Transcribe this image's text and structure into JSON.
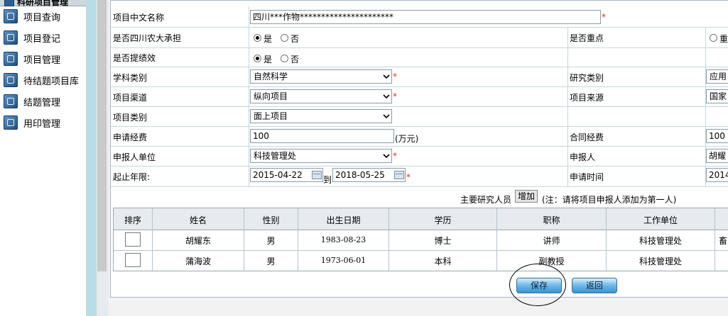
{
  "sidebar": {
    "title": "科研项目管理",
    "items": [
      {
        "label": "项目查询"
      },
      {
        "label": "项目登记"
      },
      {
        "label": "项目管理"
      },
      {
        "label": "待结题项目库"
      },
      {
        "label": "结题管理"
      },
      {
        "label": "用印管理"
      }
    ]
  },
  "form": {
    "project_name_label": "项目中文名称",
    "project_name_value": "四川***作物**********************",
    "required_mark": "*",
    "undertaken_label": "是否四川农大承担",
    "yes_label": "是",
    "no_label": "否",
    "key_label": "是否重点",
    "key_option_label": "重",
    "performance_label": "是否提绩效",
    "discipline_label": "学科类别",
    "discipline_value": "自然科学",
    "research_type_label": "研究类别",
    "research_type_value": "应用",
    "channel_label": "项目渠道",
    "channel_value": "纵向项目",
    "source_label": "项目来源",
    "source_value": "国家",
    "category_label": "项目类别",
    "category_value": "面上项目",
    "funding_label": "申请经费",
    "funding_value": "100",
    "funding_unit": "(万元)",
    "contract_funding_label": "合同经费",
    "contract_funding_value": "100",
    "unit_label": "申报人单位",
    "unit_value": "科技管理处",
    "applicant_label": "申报人",
    "applicant_value": "胡耀",
    "period_label": "起止年限:",
    "start_date": "2015-04-22",
    "to_label": "到",
    "end_date": "2018-05-25",
    "apply_time_label": "申请时间",
    "apply_time_value": "2014",
    "researchers_label": "主要研究人员",
    "add_button": "增加",
    "researchers_note": "(注：请将项目申报人添加为第一人)"
  },
  "table": {
    "headers": [
      "排序",
      "姓名",
      "性别",
      "出生日期",
      "学历",
      "职称",
      "工作单位"
    ],
    "rows": [
      {
        "name": "胡耀东",
        "gender": "男",
        "birth": "1983-08-23",
        "education": "博士",
        "title": "讲师",
        "unit": "科技管理处",
        "extra": "畜"
      },
      {
        "name": "蒲海波",
        "gender": "男",
        "birth": "1973-06-01",
        "education": "本科",
        "title": "副教授",
        "unit": "科技管理处",
        "extra": ""
      }
    ]
  },
  "actions": {
    "save": "保存",
    "back": "返回"
  }
}
